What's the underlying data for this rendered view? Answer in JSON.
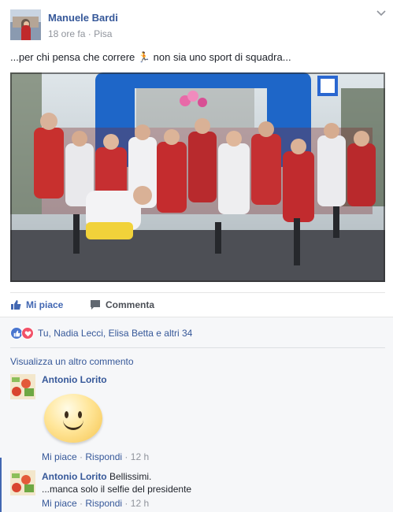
{
  "post": {
    "author": "Manuele Bardi",
    "time": "18 ore fa",
    "location": "Pisa",
    "text_before": "...per chi pensa che correre ",
    "emoji": "🏃",
    "text_after": " non sia uno sport di squadra...",
    "photo_icon": "group-runners-photo"
  },
  "actions": {
    "like_label": "Mi piace",
    "comment_label": "Commenta"
  },
  "reactions": {
    "summary": "Tu, Nadia Lecci, Elisa Betta e altri 34"
  },
  "comments": {
    "view_more": "Visualizza un altro commento",
    "items": [
      {
        "author": "Antonio Lorito",
        "text": "",
        "sticker": "smiley-sticker",
        "like": "Mi piace",
        "reply": "Rispondi",
        "time": "12 h"
      },
      {
        "author": "Antonio Lorito",
        "text_line1": "Bellissimi.",
        "text_line2": "...manca solo il selfie del presidente",
        "like": "Mi piace",
        "reply": "Rispondi",
        "time": "12 h"
      }
    ]
  },
  "colors": {
    "link": "#365899",
    "like_blue": "#4267b2",
    "love_red": "#f25268",
    "muted": "#90949c"
  }
}
